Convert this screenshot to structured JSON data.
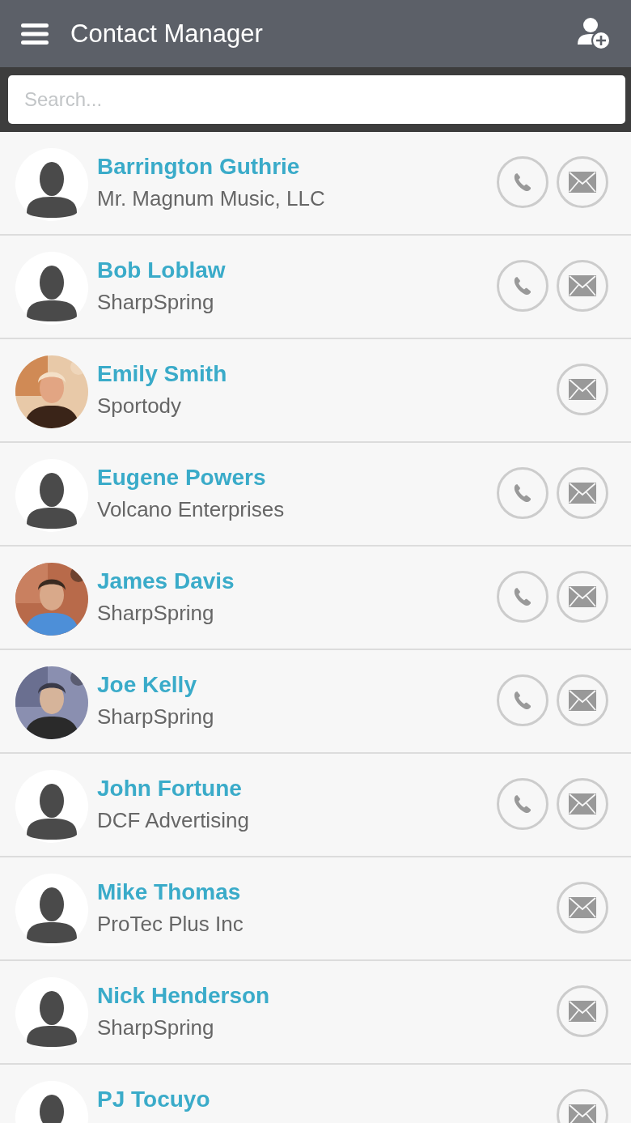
{
  "app_bar": {
    "title": "Contact Manager"
  },
  "search": {
    "placeholder": "Search..."
  },
  "contacts": [
    {
      "name": "Barrington Guthrie",
      "company": "Mr. Magnum Music, LLC",
      "avatar": {
        "kind": "silhouette"
      },
      "phone": true
    },
    {
      "name": "Bob Loblaw",
      "company": "SharpSpring",
      "avatar": {
        "kind": "silhouette"
      },
      "phone": true
    },
    {
      "name": "Emily Smith",
      "company": "Sportody",
      "phone": false
    },
    {
      "name": "Eugene Powers",
      "company": "Volcano Enterprises",
      "avatar": {
        "kind": "silhouette"
      },
      "phone": true
    },
    {
      "name": "James Davis",
      "company": "SharpSpring",
      "phone": true
    },
    {
      "name": "Joe Kelly",
      "company": "SharpSpring",
      "phone": true
    },
    {
      "name": "John Fortune",
      "company": "DCF Advertising",
      "avatar": {
        "kind": "silhouette"
      },
      "phone": true
    },
    {
      "name": "Mike Thomas",
      "company": "ProTec Plus Inc",
      "avatar": {
        "kind": "silhouette"
      },
      "phone": false
    },
    {
      "name": "Nick Henderson",
      "company": "SharpSpring",
      "avatar": {
        "kind": "silhouette"
      },
      "phone": false
    },
    {
      "name": "PJ Tocuyo",
      "avatar": {
        "kind": "silhouette"
      },
      "phone": false
    }
  ]
}
